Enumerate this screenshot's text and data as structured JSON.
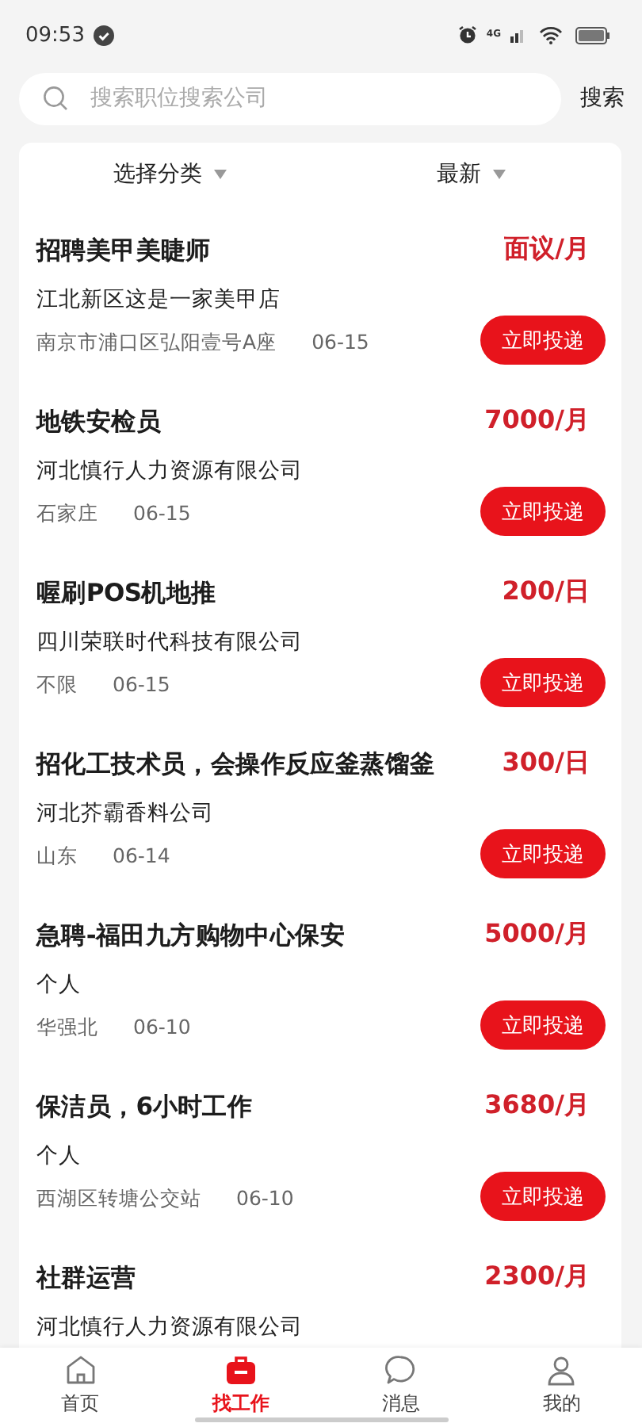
{
  "status_bar": {
    "time": "09:53",
    "network": "4G"
  },
  "search": {
    "placeholder": "搜索职位搜索公司",
    "button": "搜索"
  },
  "filters": [
    {
      "label": "选择分类"
    },
    {
      "label": "最新"
    }
  ],
  "jobs": [
    {
      "title": "招聘美甲美睫师",
      "salary": "面议/月",
      "company": "江北新区这是一家美甲店",
      "location": "南京市浦口区弘阳壹号A座",
      "date": "06-15",
      "button": "立即投递"
    },
    {
      "title": "地铁安检员",
      "salary": "7000/月",
      "company": "河北慎行人力资源有限公司",
      "location": "石家庄",
      "date": "06-15",
      "button": "立即投递"
    },
    {
      "title": "喔刷POS机地推",
      "salary": "200/日",
      "company": "四川荣联时代科技有限公司",
      "location": "不限",
      "date": "06-15",
      "button": "立即投递"
    },
    {
      "title": "招化工技术员，会操作反应釜蒸馏釜",
      "salary": "300/日",
      "company": "河北芥霸香料公司",
      "location": "山东",
      "date": "06-14",
      "button": "立即投递"
    },
    {
      "title": "急聘-福田九方购物中心保安",
      "salary": "5000/月",
      "company": "个人",
      "location": "华强北",
      "date": "06-10",
      "button": "立即投递"
    },
    {
      "title": "保洁员，6小时工作",
      "salary": "3680/月",
      "company": "个人",
      "location": "西湖区转塘公交站",
      "date": "06-10",
      "button": "立即投递"
    },
    {
      "title": "社群运营",
      "salary": "2300/月",
      "company": "河北慎行人力资源有限公司"
    }
  ],
  "nav": [
    {
      "kind": "home",
      "label": "首页",
      "selected": false
    },
    {
      "kind": "jobs",
      "label": "找工作",
      "selected": true
    },
    {
      "kind": "messages",
      "label": "消息",
      "selected": false
    },
    {
      "kind": "profile",
      "label": "我的",
      "selected": false
    }
  ]
}
